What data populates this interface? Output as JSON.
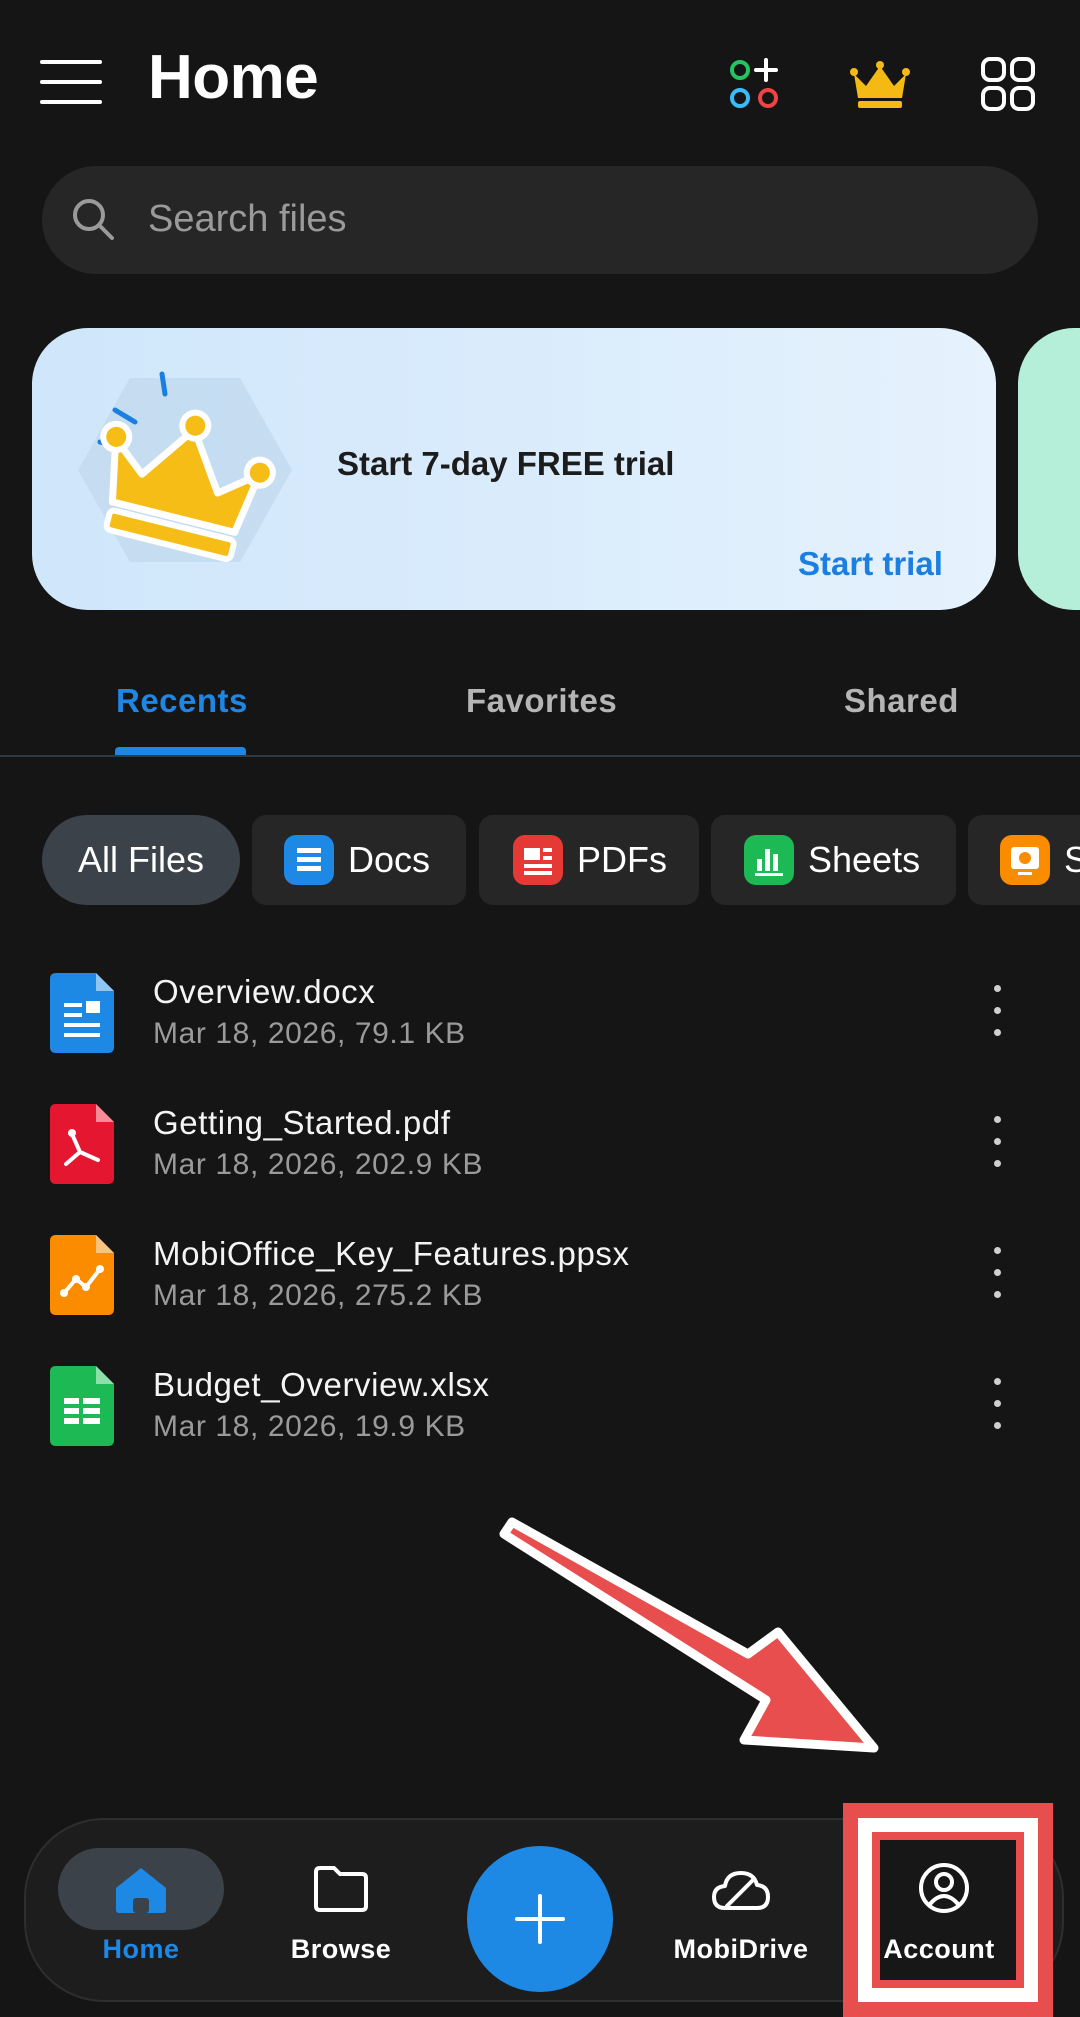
{
  "header": {
    "title": "Home",
    "menu_icon": "hamburger-menu-icon",
    "apps_icon": "add-apps-icon",
    "premium_icon": "crown-icon",
    "grid_icon": "grid-view-icon"
  },
  "search": {
    "placeholder": "Search files"
  },
  "promo": {
    "text": "Start 7-day FREE trial",
    "action": "Start trial",
    "accent_color": "#1a7fe0"
  },
  "tabs": [
    {
      "label": "Recents",
      "active": true
    },
    {
      "label": "Favorites",
      "active": false
    },
    {
      "label": "Shared",
      "active": false
    }
  ],
  "filters": [
    {
      "label": "All Files",
      "active": true
    },
    {
      "label": "Docs",
      "icon": "docs-icon",
      "color": "#1e88e5"
    },
    {
      "label": "PDFs",
      "icon": "pdfs-icon",
      "color": "#e53935"
    },
    {
      "label": "Sheets",
      "icon": "sheets-icon",
      "color": "#1db954"
    },
    {
      "label": "S",
      "icon": "slides-icon",
      "color": "#fb8c00"
    }
  ],
  "files": [
    {
      "name": "Overview.docx",
      "meta": "Mar 18, 2026, 79.1 KB",
      "type": "docx"
    },
    {
      "name": "Getting_Started.pdf",
      "meta": "Mar 18, 2026, 202.9 KB",
      "type": "pdf"
    },
    {
      "name": "MobiOffice_Key_Features.ppsx",
      "meta": "Mar 18, 2026, 275.2 KB",
      "type": "ppsx"
    },
    {
      "name": "Budget_Overview.xlsx",
      "meta": "Mar 18, 2026, 19.9 KB",
      "type": "xlsx"
    }
  ],
  "bottom_nav": [
    {
      "label": "Home",
      "active": true,
      "icon": "home-icon"
    },
    {
      "label": "Browse",
      "icon": "folder-icon"
    },
    {
      "label": "",
      "icon": "plus-icon"
    },
    {
      "label": "MobiDrive",
      "icon": "cloud-icon"
    },
    {
      "label": "Account",
      "icon": "account-icon"
    }
  ],
  "colors": {
    "accent": "#1f86e3",
    "annotation": "#e84e4e",
    "background": "#151515"
  }
}
